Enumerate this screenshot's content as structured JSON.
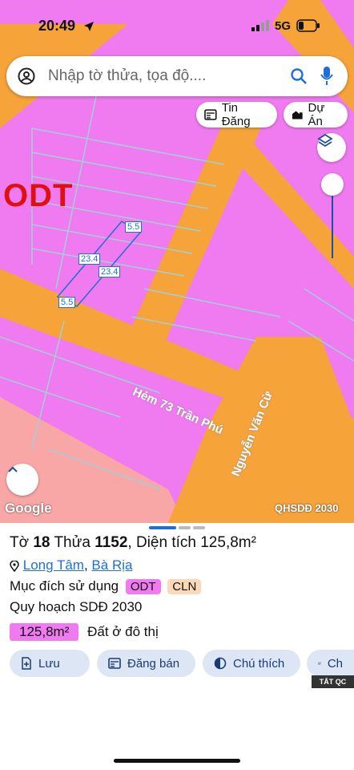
{
  "status": {
    "time": "20:49",
    "network": "5G"
  },
  "search": {
    "placeholder": "Nhập tờ thửa, tọa độ...."
  },
  "chips": {
    "news": "Tin Đăng",
    "projects": "Dự Án"
  },
  "map": {
    "zone_label": "ODT",
    "plot_dims": {
      "top": "5.5",
      "bottom": "5.5",
      "side_left": "23.4",
      "side_right": "23.4"
    },
    "road1": "Hẻm 73 Trần Phú",
    "road2": "Nguyễn Văn Cừ",
    "attribution": "Google",
    "layer_label": "QHSDĐ 2030",
    "colors": {
      "residential": "#f07af0",
      "road": "#f6a33a",
      "cln": "#f8a6a6",
      "parcel_lines": "#9fd0d7",
      "plot_box": "#1f6fd6"
    }
  },
  "sheet": {
    "title_prefix": "Tờ",
    "sheet_no": "18",
    "plot_prefix": "Thửa",
    "plot_no": "1152",
    "area_label": "Diện tích 125,8m²",
    "location_1": "Long Tâm",
    "location_2": "Bà Rịa",
    "usage_label": "Mục đích sử dụng",
    "usage_badges": [
      "ODT",
      "CLN"
    ],
    "planning_label": "Quy hoạch SDĐ 2030",
    "planning_area": "125,8m²",
    "planning_desc": "Đất ở đô thị",
    "actions": [
      "Lưu",
      "Đăng bán",
      "Chú thích",
      "Ch"
    ],
    "tat_qc": "TẮT QC"
  }
}
